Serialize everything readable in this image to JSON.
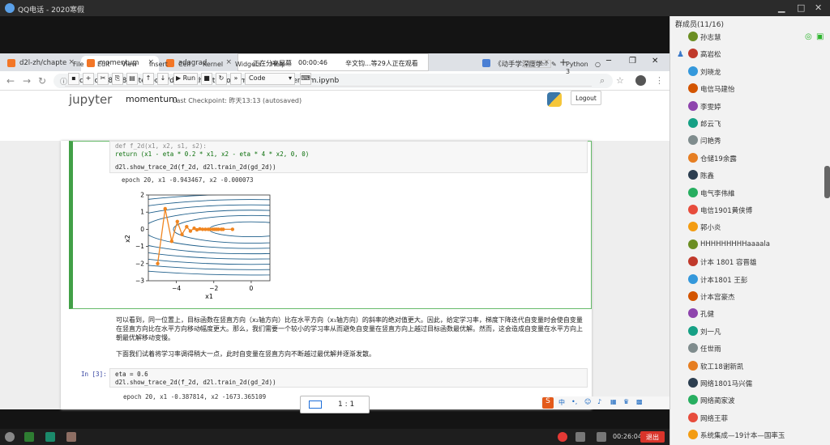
{
  "qq": {
    "title": "QQ电话 - 2020寒假",
    "controls": [
      "▁",
      "□",
      "✕"
    ]
  },
  "browser": {
    "tabs": [
      {
        "label": "d2l-zh/chapte",
        "x": "×"
      },
      {
        "label": "momentum",
        "x": "×"
      },
      {
        "label": "adagrad",
        "x": "×"
      },
      {
        "label": "《动手学深度学",
        "x": "×"
      }
    ],
    "new_tab": "+",
    "share": {
      "status": "正在分享屏幕",
      "time": "00:00:46",
      "viewers": "辛文钧...等29人正在观看"
    },
    "url": "localhost:8888/notebooks/d2l-zh/chapter_optimization/momentum.ipynb",
    "window_controls": [
      "─",
      "❐",
      "✕"
    ]
  },
  "jupyter": {
    "logo": "jupyter",
    "notebook": "momentum",
    "checkpoint": "Last Checkpoint: 昨天13:13  (autosaved)",
    "logout": "Logout",
    "menus": [
      "File",
      "Edit",
      "View",
      "Insert",
      "Cell",
      "Kernel",
      "Widgets",
      "Help"
    ],
    "trusted": "Trusted",
    "kernel": "Python 3",
    "toolbar": {
      "run": "Run",
      "celltype": "Code"
    }
  },
  "cell1": {
    "code_line1": "def f_2d(x1, x2, s1, s2):",
    "code_line2": "    return (x1 - eta * 0.2 * x1, x2 - eta * 4 * x2, 0, 0)",
    "code_line3": "d2l.show_trace_2d(f_2d, d2l.train_2d(gd_2d))",
    "output": "epoch 20, x1 -0.943467, x2 -0.000073"
  },
  "markdown": {
    "para1": "可以看到，同一位置上，目标函数在竖直方向（x₂轴方向）比在水平方向（x₁轴方向）的斜率的绝对值更大。因此，给定学习率，梯度下降迭代自变量时会使自变量在竖直方向比在水平方向移动幅度更大。那么，我们需要一个较小的学习率从而避免自变量在竖直方向上越过目标函数最优解。然而，这会造成自变量在水平方向上朝最优解移动变慢。",
    "para2": "下面我们试着将学习率调得稍大一点，此时自变量在竖直方向不断越过最优解并逐渐发散。"
  },
  "cell2": {
    "prompt": "In  [3]:",
    "line1": "eta = 0.6",
    "line2": "d2l.show_trace_2d(f_2d, d2l.train_2d(gd_2d))",
    "output": "epoch 20, x1 -0.387814, x2 -1673.365109"
  },
  "zoom": "1 : 1",
  "members": {
    "header": "群成员(11/16)",
    "list": [
      "孙志慧",
      "高岩松",
      "刘晓龙",
      "电信马建怡",
      "李雯婷",
      "郎云飞",
      "闫艳秀",
      "仓储19余露",
      "陈鑫",
      "电气李伟維",
      "电信1901黄侠博",
      "郭小炎",
      "HHHHHHHHHaaaala",
      "计本 1801 容晋雄",
      "计本1801 王彭",
      "计本宫豪杰",
      "孔健",
      "刘一凡",
      "任世雨",
      "软工18谢新凯",
      "网络1801马兴儒",
      "网络蔺家波",
      "网络王菲",
      "系统集成—19计本—国率玉"
    ]
  },
  "taskbar": {
    "time": "00:26:04",
    "exit": "退出"
  },
  "chart_data": {
    "type": "line",
    "xlabel": "x1",
    "ylabel": "x2",
    "xlim": [
      -5.5,
      1.0
    ],
    "ylim": [
      -3,
      2
    ],
    "xticks": [
      "−4",
      "−2",
      "0"
    ],
    "yticks": [
      "2",
      "1",
      "0",
      "−1",
      "−2",
      "−3"
    ],
    "series": [
      {
        "x": [
          -5.0,
          -4.6,
          -4.25,
          -3.95,
          -3.7,
          -3.45,
          -3.25,
          -3.05,
          -2.9,
          -2.75,
          -2.6,
          -2.45,
          -2.3,
          -2.2,
          -2.05,
          -1.95,
          -1.85,
          -1.75,
          -1.6,
          -1.5,
          -1.0
        ],
        "y": [
          -2.0,
          1.2,
          -0.7,
          0.45,
          -0.3,
          0.15,
          -0.1,
          0.06,
          -0.03,
          0.02,
          0.0,
          0.0,
          0.0,
          0.0,
          0.0,
          0.0,
          0.0,
          0.0,
          0.0,
          0.0,
          0.0
        ]
      }
    ]
  }
}
